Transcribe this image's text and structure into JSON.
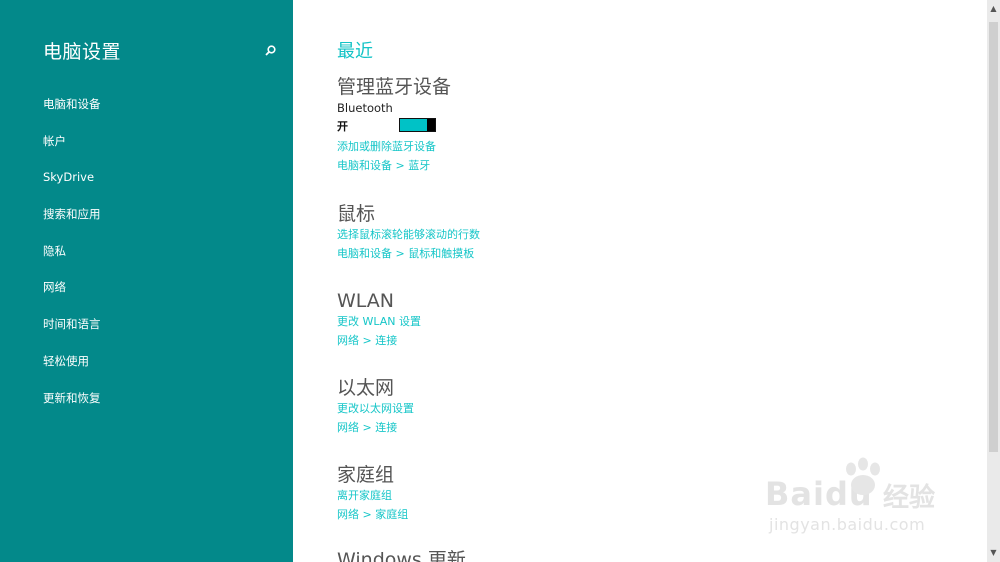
{
  "sidebar": {
    "title": "电脑设置",
    "search_icon": "search-icon",
    "items": [
      {
        "label": "电脑和设备"
      },
      {
        "label": "帐户"
      },
      {
        "label": "SkyDrive"
      },
      {
        "label": "搜索和应用"
      },
      {
        "label": "隐私"
      },
      {
        "label": "网络"
      },
      {
        "label": "时间和语言"
      },
      {
        "label": "轻松使用"
      },
      {
        "label": "更新和恢复"
      }
    ]
  },
  "main": {
    "heading": "最近",
    "sections": [
      {
        "title": "管理蓝牙设备",
        "bluetooth_label": "Bluetooth",
        "toggle_state": "开",
        "toggle_on": true,
        "links": [
          "添加或删除蓝牙设备",
          "电脑和设备 > 蓝牙"
        ]
      },
      {
        "title": "鼠标",
        "links": [
          "选择鼠标滚轮能够滚动的行数",
          "电脑和设备 > 鼠标和触摸板"
        ]
      },
      {
        "title": "WLAN",
        "links": [
          "更改 WLAN 设置",
          "网络 > 连接"
        ]
      },
      {
        "title": "以太网",
        "links": [
          "更改以太网设置",
          "网络 > 连接"
        ]
      },
      {
        "title": "家庭组",
        "links": [
          "离开家庭组",
          "网络 > 家庭组"
        ]
      },
      {
        "title": "Windows 更新"
      }
    ]
  },
  "watermark": {
    "brand": "Baidu",
    "suffix": "经验",
    "url": "jingyan.baidu.com"
  },
  "colors": {
    "sidebar_bg": "#03898a",
    "accent": "#13c3c6",
    "toggle_fill": "#00c2c6"
  }
}
